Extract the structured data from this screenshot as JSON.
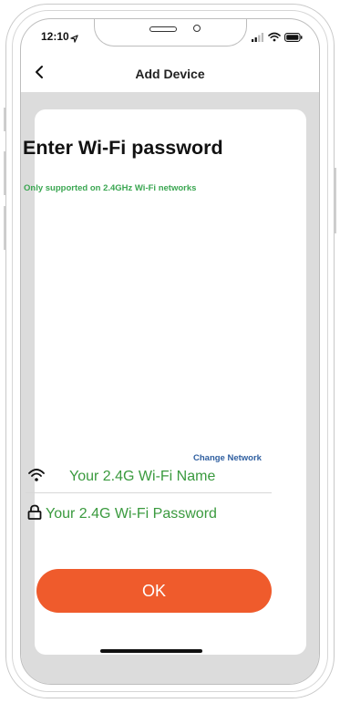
{
  "status_bar": {
    "time": "12:10",
    "icons": [
      "location-arrow-icon",
      "signal-bars-icon",
      "wifi-icon",
      "battery-icon"
    ]
  },
  "nav": {
    "back_icon": "chevron-left-icon",
    "title": "Add Device"
  },
  "main": {
    "heading": "Enter Wi-Fi password",
    "subheading": "Only supported on 2.4GHz Wi-Fi networks",
    "change_network": "Change Network",
    "wifi_icon": "wifi-icon",
    "wifi_name": "Your 2.4G Wi-Fi Name",
    "lock_icon": "lock-icon",
    "password": "Your 2.4G Wi-Fi Password",
    "ok_label": "OK"
  },
  "colors": {
    "accent": "#ef5b2c",
    "subheading_green": "#3aa651",
    "field_green": "#3a9a3e",
    "link_blue": "#2f5fa0",
    "background_gray": "#dcdcdc"
  }
}
